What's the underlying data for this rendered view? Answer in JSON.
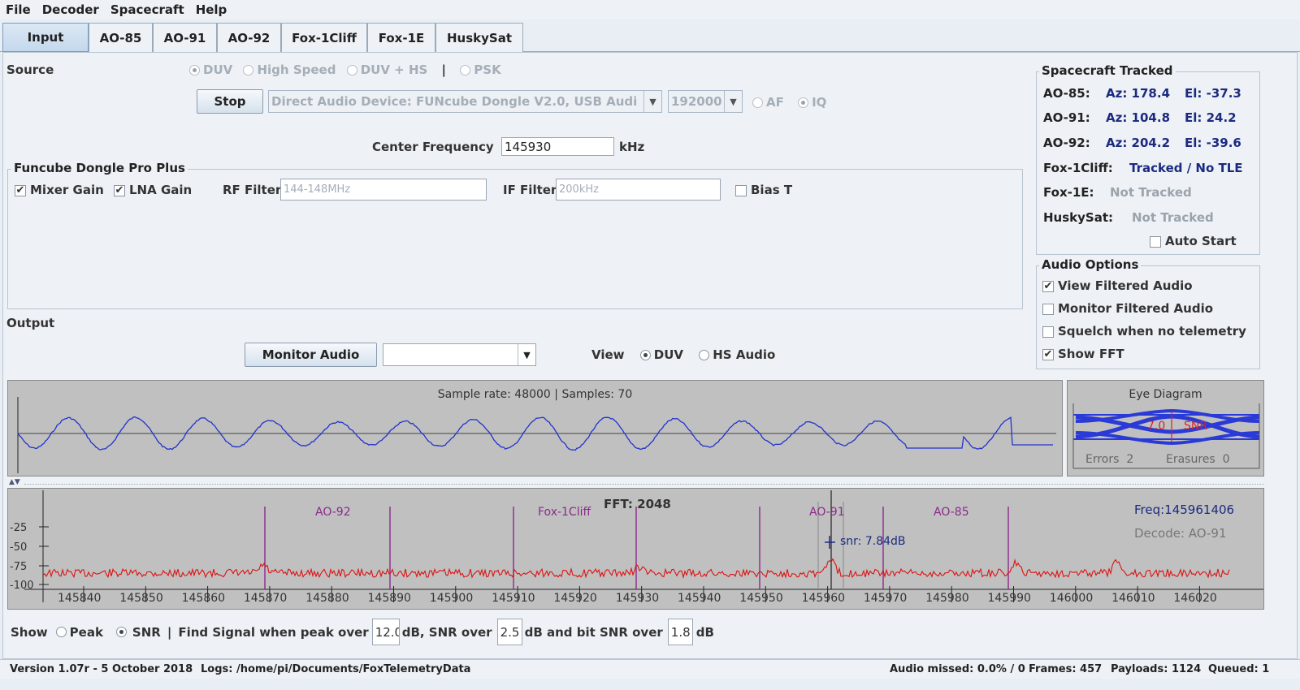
{
  "menu": [
    "File",
    "Decoder",
    "Spacecraft",
    "Help"
  ],
  "tabs": [
    "Input",
    "AO-85",
    "AO-91",
    "AO-92",
    "Fox-1Cliff",
    "Fox-1E",
    "HuskySat"
  ],
  "source": {
    "label": "Source",
    "modes": [
      "DUV",
      "High Speed",
      "DUV + HS",
      "PSK"
    ],
    "mode_sep": "|",
    "stop_label": "Stop",
    "device": "Direct Audio Device: FUNcube Dongle V2.0, USB Audi",
    "rate": "192000",
    "af_label": "AF",
    "iq_label": "IQ",
    "center_freq_label": "Center Frequency",
    "center_freq_value": "145930",
    "center_freq_unit": "kHz"
  },
  "funcube": {
    "title": "Funcube Dongle Pro Plus",
    "mixer_gain": "Mixer Gain",
    "lna_gain": "LNA Gain",
    "rf_filter_label": "RF Filter",
    "rf_filter_value": "144-148MHz",
    "if_filter_label": "IF Filter",
    "if_filter_value": "200kHz",
    "bias_t": "Bias T"
  },
  "output": {
    "label": "Output",
    "monitor_label": "Monitor Audio",
    "view_label": "View",
    "view_duv": "DUV",
    "view_hs": "HS Audio"
  },
  "tracked": {
    "title": "Spacecraft Tracked",
    "rows": [
      {
        "name": "AO-85:",
        "az": "Az: 178.4",
        "el": "El: -37.3"
      },
      {
        "name": "AO-91:",
        "az": "Az: 104.8",
        "el": "El: 24.2"
      },
      {
        "name": "AO-92:",
        "az": "Az: 204.2",
        "el": "El: -39.6"
      }
    ],
    "cliff_name": "Fox-1Cliff:",
    "cliff_status": "Tracked / No TLE",
    "fox1e_name": "Fox-1E:",
    "fox1e_status": "Not Tracked",
    "husky_name": "HuskySat:",
    "husky_status": "Not Tracked",
    "auto_start": "Auto Start"
  },
  "audio": {
    "title": "Audio Options",
    "view_filtered": "View Filtered Audio",
    "monitor_filtered": "Monitor Filtered Audio",
    "squelch": "Squelch when no telemetry",
    "show_fft": "Show FFT"
  },
  "wave": {
    "caption": "Sample rate: 48000 | Samples: 70"
  },
  "eye": {
    "title": "Eye Diagram",
    "snr_value": "7.0",
    "snr_label": "SNR",
    "errors": "Errors  2",
    "erasures": "Erasures  0"
  },
  "fft": {
    "title": "FFT: 2048",
    "freq": "Freq:145961406",
    "decode": "Decode: AO-91",
    "snr": "snr: 7.84dB",
    "yticks": [
      "-25",
      "-50",
      "-75",
      "-100"
    ],
    "xticks": [
      "145840",
      "145850",
      "145860",
      "145870",
      "145880",
      "145890",
      "145900",
      "145910",
      "145920",
      "145930",
      "145940",
      "145950",
      "145960",
      "145970",
      "145980",
      "145990",
      "146000",
      "146010",
      "146020"
    ],
    "sat_labels": [
      "AO-92",
      "Fox-1Cliff",
      "AO-91",
      "AO-85"
    ]
  },
  "threshold": {
    "show": "Show",
    "peak": "Peak",
    "snr": "SNR",
    "sep": "|",
    "t1": "Find Signal when peak over",
    "v1": "12.0",
    "t2": "dB, SNR over",
    "v2": "2.5",
    "t3": "dB and bit SNR over",
    "v3": "1.8",
    "t4": "dB"
  },
  "status": {
    "version": "Version 1.07r - 5 October 2018",
    "logs": "Logs: /home/pi/Documents/FoxTelemetryData",
    "audio_missed": "Audio missed: 0.0% / 0",
    "frames": "Frames: 457",
    "payloads": "Payloads: 1124",
    "queued": "Queued: 1"
  },
  "colors": {
    "wave": "#2233cc",
    "fft": "#dd1111",
    "marker": "#8a2a8a",
    "navy": "#1b2a80"
  }
}
